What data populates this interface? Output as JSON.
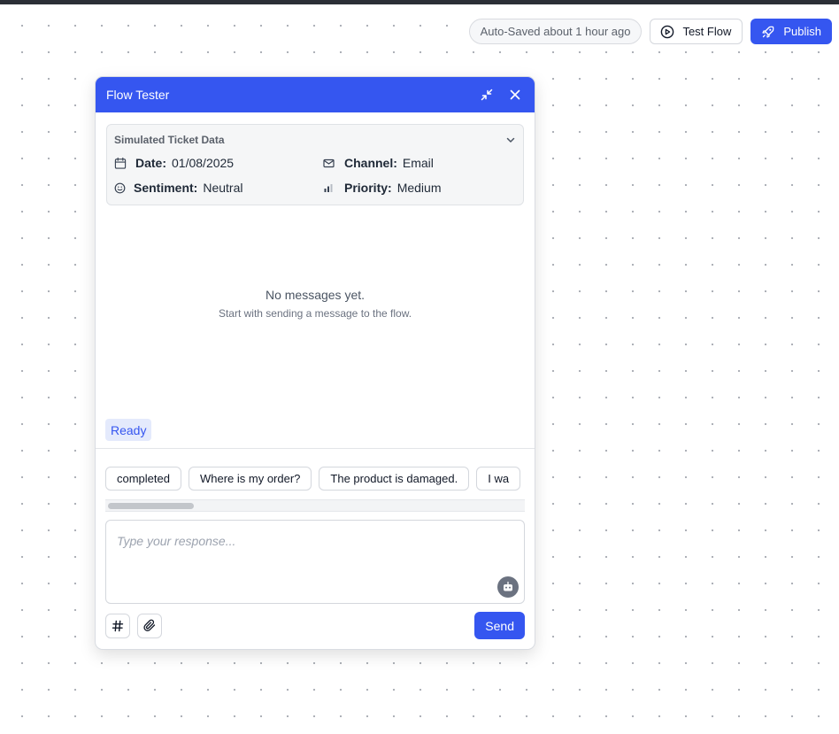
{
  "toolbar": {
    "autosave_status": "Auto-Saved about 1 hour ago",
    "test_flow_label": "Test Flow",
    "publish_label": "Publish"
  },
  "colors": {
    "accent": "#3556f0",
    "ready_bg": "#e4eafc",
    "canvas_dot": "#a9adb4"
  },
  "icons": {
    "test_flow": "play-circle-icon",
    "publish": "rocket-icon",
    "minimize": "minimize-icon",
    "close": "close-icon",
    "collapse": "chevron-down-icon",
    "date": "calendar-icon",
    "channel": "mail-icon",
    "sentiment": "smile-icon",
    "priority": "signal-bars-icon",
    "assistant": "bot-icon",
    "hashtag": "hashtag-icon",
    "attach": "paperclip-icon"
  },
  "panel": {
    "title": "Flow Tester",
    "ticket": {
      "heading": "Simulated Ticket Data",
      "fields": {
        "date": {
          "label": "Date:",
          "value": "01/08/2025"
        },
        "channel": {
          "label": "Channel:",
          "value": "Email"
        },
        "sentiment": {
          "label": "Sentiment:",
          "value": "Neutral"
        },
        "priority": {
          "label": "Priority:",
          "value": "Medium"
        }
      }
    },
    "empty_title": "No messages yet.",
    "empty_subtitle": "Start with sending a message to the flow.",
    "status_badge": "Ready",
    "suggestions": [
      "completed",
      "Where is my order?",
      "The product is damaged.",
      "I wa"
    ],
    "input_placeholder": "Type your response...",
    "send_label": "Send"
  }
}
